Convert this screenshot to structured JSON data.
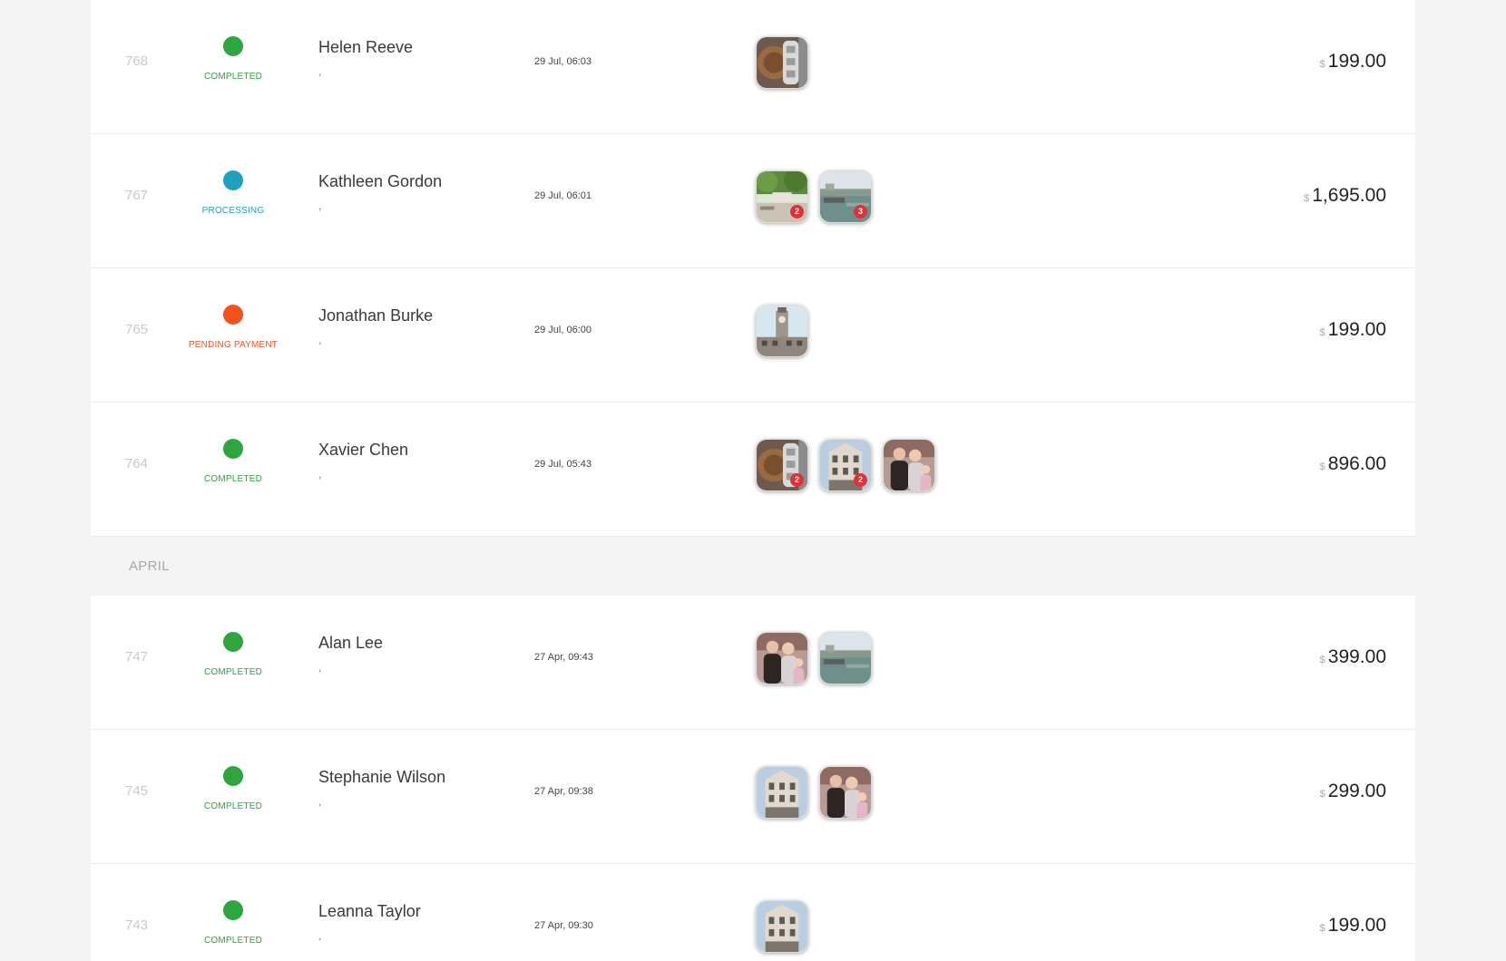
{
  "colors": {
    "completed": "#2ea53d",
    "processing": "#1fa0c0",
    "pending_payment": "#f4511e"
  },
  "groups": [
    {
      "label": "",
      "orders": [
        {
          "id": "768",
          "status": "COMPLETED",
          "status_key": "completed",
          "customer": "Helen Reeve",
          "subline": ",",
          "date": "29 Jul, 06:03",
          "thumbnails": [
            {
              "icon": "tower-photo-icon",
              "badge": ""
            }
          ],
          "currency": "$",
          "total": "199.00"
        },
        {
          "id": "767",
          "status": "PROCESSING",
          "status_key": "processing",
          "customer": "Kathleen Gordon",
          "subline": ",",
          "date": "29 Jul, 06:01",
          "thumbnails": [
            {
              "icon": "garden-photo-icon",
              "badge": "2"
            },
            {
              "icon": "river-photo-icon",
              "badge": "3"
            }
          ],
          "currency": "$",
          "total": "1,695.00"
        },
        {
          "id": "765",
          "status": "PENDING PAYMENT",
          "status_key": "pending_payment",
          "customer": "Jonathan Burke",
          "subline": ",",
          "date": "29 Jul, 06:00",
          "thumbnails": [
            {
              "icon": "clocktower-photo-icon",
              "badge": ""
            }
          ],
          "currency": "$",
          "total": "199.00"
        },
        {
          "id": "764",
          "status": "COMPLETED",
          "status_key": "completed",
          "customer": "Xavier Chen",
          "subline": ",",
          "date": "29 Jul, 05:43",
          "thumbnails": [
            {
              "icon": "tower-photo-icon",
              "badge": "2"
            },
            {
              "icon": "building-photo-icon",
              "badge": "2"
            },
            {
              "icon": "people-photo-icon",
              "badge": ""
            }
          ],
          "currency": "$",
          "total": "896.00"
        }
      ]
    },
    {
      "label": "APRIL",
      "orders": [
        {
          "id": "747",
          "status": "COMPLETED",
          "status_key": "completed",
          "customer": "Alan Lee",
          "subline": ",",
          "date": "27 Apr, 09:43",
          "thumbnails": [
            {
              "icon": "people-photo-icon",
              "badge": ""
            },
            {
              "icon": "river-photo-icon",
              "badge": ""
            }
          ],
          "currency": "$",
          "total": "399.00"
        },
        {
          "id": "745",
          "status": "COMPLETED",
          "status_key": "completed",
          "customer": "Stephanie Wilson",
          "subline": ",",
          "date": "27 Apr, 09:38",
          "thumbnails": [
            {
              "icon": "building-photo-icon",
              "badge": ""
            },
            {
              "icon": "people-photo-icon",
              "badge": ""
            }
          ],
          "currency": "$",
          "total": "299.00"
        },
        {
          "id": "743",
          "status": "COMPLETED",
          "status_key": "completed",
          "customer": "Leanna Taylor",
          "subline": ",",
          "date": "27 Apr, 09:30",
          "thumbnails": [
            {
              "icon": "building-photo-icon",
              "badge": ""
            }
          ],
          "currency": "$",
          "total": "199.00"
        }
      ]
    }
  ]
}
